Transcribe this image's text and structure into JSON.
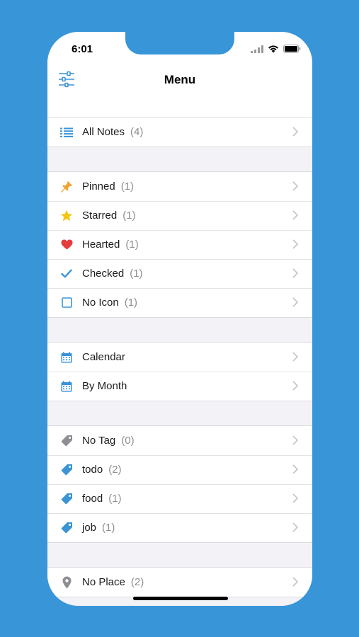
{
  "status": {
    "time": "6:01"
  },
  "nav": {
    "title": "Menu"
  },
  "colors": {
    "background": "#3896d8",
    "accent": "#3a94d6",
    "pin": "#f0a32b",
    "star": "#f6c412",
    "heart": "#e53b3b",
    "tag_gray": "#8e8e93"
  },
  "groups": [
    {
      "rows": [
        {
          "icon": "list-icon",
          "label": "All Notes",
          "count": "(4)"
        }
      ]
    },
    {
      "rows": [
        {
          "icon": "pin-icon",
          "label": "Pinned",
          "count": "(1)"
        },
        {
          "icon": "star-icon",
          "label": "Starred",
          "count": "(1)"
        },
        {
          "icon": "heart-icon",
          "label": "Hearted",
          "count": "(1)"
        },
        {
          "icon": "checkmark-icon",
          "label": "Checked",
          "count": "(1)"
        },
        {
          "icon": "square-icon",
          "label": "No Icon",
          "count": "(1)"
        }
      ]
    },
    {
      "rows": [
        {
          "icon": "calendar-icon",
          "label": "Calendar",
          "count": ""
        },
        {
          "icon": "calendar-icon",
          "label": "By Month",
          "count": ""
        }
      ]
    },
    {
      "rows": [
        {
          "icon": "tag-icon",
          "label": "No Tag",
          "count": "(0)"
        },
        {
          "icon": "tag-icon",
          "label": "todo",
          "count": "(2)"
        },
        {
          "icon": "tag-icon",
          "label": "food",
          "count": "(1)"
        },
        {
          "icon": "tag-icon",
          "label": "job",
          "count": "(1)"
        }
      ]
    },
    {
      "rows": [
        {
          "icon": "location-pin-icon",
          "label": "No Place",
          "count": "(2)"
        }
      ]
    }
  ]
}
